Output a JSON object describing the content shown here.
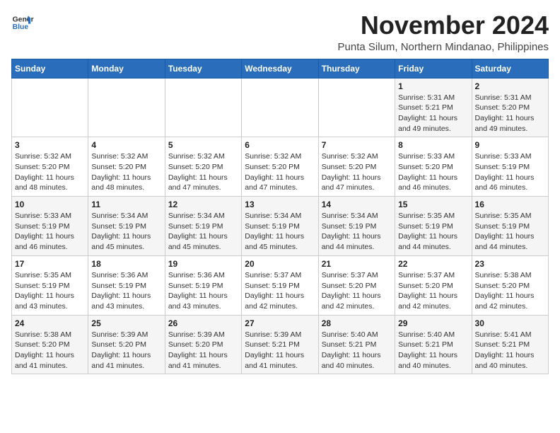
{
  "header": {
    "logo_line1": "General",
    "logo_line2": "Blue",
    "month": "November 2024",
    "location": "Punta Silum, Northern Mindanao, Philippines"
  },
  "weekdays": [
    "Sunday",
    "Monday",
    "Tuesday",
    "Wednesday",
    "Thursday",
    "Friday",
    "Saturday"
  ],
  "weeks": [
    [
      {
        "day": "",
        "info": ""
      },
      {
        "day": "",
        "info": ""
      },
      {
        "day": "",
        "info": ""
      },
      {
        "day": "",
        "info": ""
      },
      {
        "day": "",
        "info": ""
      },
      {
        "day": "1",
        "info": "Sunrise: 5:31 AM\nSunset: 5:21 PM\nDaylight: 11 hours\nand 49 minutes."
      },
      {
        "day": "2",
        "info": "Sunrise: 5:31 AM\nSunset: 5:20 PM\nDaylight: 11 hours\nand 49 minutes."
      }
    ],
    [
      {
        "day": "3",
        "info": "Sunrise: 5:32 AM\nSunset: 5:20 PM\nDaylight: 11 hours\nand 48 minutes."
      },
      {
        "day": "4",
        "info": "Sunrise: 5:32 AM\nSunset: 5:20 PM\nDaylight: 11 hours\nand 48 minutes."
      },
      {
        "day": "5",
        "info": "Sunrise: 5:32 AM\nSunset: 5:20 PM\nDaylight: 11 hours\nand 47 minutes."
      },
      {
        "day": "6",
        "info": "Sunrise: 5:32 AM\nSunset: 5:20 PM\nDaylight: 11 hours\nand 47 minutes."
      },
      {
        "day": "7",
        "info": "Sunrise: 5:32 AM\nSunset: 5:20 PM\nDaylight: 11 hours\nand 47 minutes."
      },
      {
        "day": "8",
        "info": "Sunrise: 5:33 AM\nSunset: 5:20 PM\nDaylight: 11 hours\nand 46 minutes."
      },
      {
        "day": "9",
        "info": "Sunrise: 5:33 AM\nSunset: 5:19 PM\nDaylight: 11 hours\nand 46 minutes."
      }
    ],
    [
      {
        "day": "10",
        "info": "Sunrise: 5:33 AM\nSunset: 5:19 PM\nDaylight: 11 hours\nand 46 minutes."
      },
      {
        "day": "11",
        "info": "Sunrise: 5:34 AM\nSunset: 5:19 PM\nDaylight: 11 hours\nand 45 minutes."
      },
      {
        "day": "12",
        "info": "Sunrise: 5:34 AM\nSunset: 5:19 PM\nDaylight: 11 hours\nand 45 minutes."
      },
      {
        "day": "13",
        "info": "Sunrise: 5:34 AM\nSunset: 5:19 PM\nDaylight: 11 hours\nand 45 minutes."
      },
      {
        "day": "14",
        "info": "Sunrise: 5:34 AM\nSunset: 5:19 PM\nDaylight: 11 hours\nand 44 minutes."
      },
      {
        "day": "15",
        "info": "Sunrise: 5:35 AM\nSunset: 5:19 PM\nDaylight: 11 hours\nand 44 minutes."
      },
      {
        "day": "16",
        "info": "Sunrise: 5:35 AM\nSunset: 5:19 PM\nDaylight: 11 hours\nand 44 minutes."
      }
    ],
    [
      {
        "day": "17",
        "info": "Sunrise: 5:35 AM\nSunset: 5:19 PM\nDaylight: 11 hours\nand 43 minutes."
      },
      {
        "day": "18",
        "info": "Sunrise: 5:36 AM\nSunset: 5:19 PM\nDaylight: 11 hours\nand 43 minutes."
      },
      {
        "day": "19",
        "info": "Sunrise: 5:36 AM\nSunset: 5:19 PM\nDaylight: 11 hours\nand 43 minutes."
      },
      {
        "day": "20",
        "info": "Sunrise: 5:37 AM\nSunset: 5:19 PM\nDaylight: 11 hours\nand 42 minutes."
      },
      {
        "day": "21",
        "info": "Sunrise: 5:37 AM\nSunset: 5:20 PM\nDaylight: 11 hours\nand 42 minutes."
      },
      {
        "day": "22",
        "info": "Sunrise: 5:37 AM\nSunset: 5:20 PM\nDaylight: 11 hours\nand 42 minutes."
      },
      {
        "day": "23",
        "info": "Sunrise: 5:38 AM\nSunset: 5:20 PM\nDaylight: 11 hours\nand 42 minutes."
      }
    ],
    [
      {
        "day": "24",
        "info": "Sunrise: 5:38 AM\nSunset: 5:20 PM\nDaylight: 11 hours\nand 41 minutes."
      },
      {
        "day": "25",
        "info": "Sunrise: 5:39 AM\nSunset: 5:20 PM\nDaylight: 11 hours\nand 41 minutes."
      },
      {
        "day": "26",
        "info": "Sunrise: 5:39 AM\nSunset: 5:20 PM\nDaylight: 11 hours\nand 41 minutes."
      },
      {
        "day": "27",
        "info": "Sunrise: 5:39 AM\nSunset: 5:21 PM\nDaylight: 11 hours\nand 41 minutes."
      },
      {
        "day": "28",
        "info": "Sunrise: 5:40 AM\nSunset: 5:21 PM\nDaylight: 11 hours\nand 40 minutes."
      },
      {
        "day": "29",
        "info": "Sunrise: 5:40 AM\nSunset: 5:21 PM\nDaylight: 11 hours\nand 40 minutes."
      },
      {
        "day": "30",
        "info": "Sunrise: 5:41 AM\nSunset: 5:21 PM\nDaylight: 11 hours\nand 40 minutes."
      }
    ]
  ]
}
